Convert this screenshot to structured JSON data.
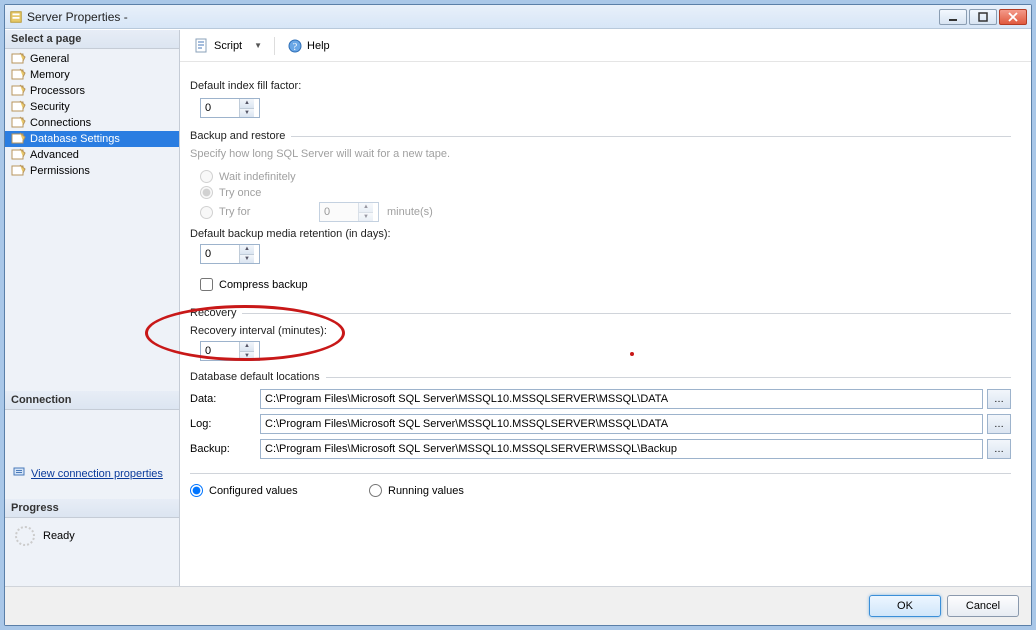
{
  "titlebar": {
    "title": "Server Properties -"
  },
  "sidebar": {
    "select_page_label": "Select a page",
    "pages": [
      {
        "label": "General"
      },
      {
        "label": "Memory"
      },
      {
        "label": "Processors"
      },
      {
        "label": "Security"
      },
      {
        "label": "Connections"
      },
      {
        "label": "Database Settings"
      },
      {
        "label": "Advanced"
      },
      {
        "label": "Permissions"
      }
    ],
    "connection_label": "Connection",
    "view_connection_props": "View connection properties",
    "progress_label": "Progress",
    "progress_status": "Ready"
  },
  "toolbar": {
    "script_label": "Script",
    "help_label": "Help"
  },
  "form": {
    "fill_factor_label": "Default index fill factor:",
    "fill_factor_value": "0",
    "backup_restore_title": "Backup and restore",
    "tape_hint": "Specify how long SQL Server will wait for a new tape.",
    "wait_indef": "Wait indefinitely",
    "try_once": "Try once",
    "try_for": "Try for",
    "try_for_value": "0",
    "try_for_unit": "minute(s)",
    "retention_label": "Default backup media retention (in days):",
    "retention_value": "0",
    "compress_label": "Compress backup",
    "recovery_title": "Recovery",
    "recovery_interval_label": "Recovery interval (minutes):",
    "recovery_interval_value": "0",
    "db_locations_title": "Database default locations",
    "data_label": "Data:",
    "data_path": "C:\\Program Files\\Microsoft SQL Server\\MSSQL10.MSSQLSERVER\\MSSQL\\DATA",
    "log_label": "Log:",
    "log_path": "C:\\Program Files\\Microsoft SQL Server\\MSSQL10.MSSQLSERVER\\MSSQL\\DATA",
    "backup_label": "Backup:",
    "backup_path": "C:\\Program Files\\Microsoft SQL Server\\MSSQL10.MSSQLSERVER\\MSSQL\\Backup",
    "configured_values": "Configured values",
    "running_values": "Running values"
  },
  "footer": {
    "ok": "OK",
    "cancel": "Cancel"
  }
}
